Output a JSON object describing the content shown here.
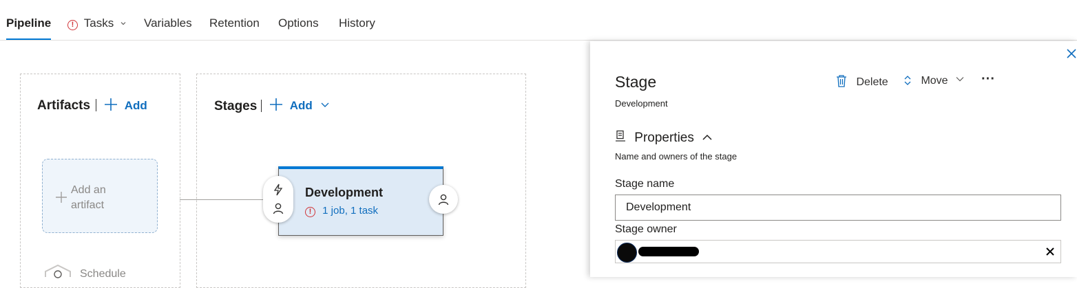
{
  "tabs": [
    {
      "label": "Pipeline",
      "active": true
    },
    {
      "label": "Tasks",
      "warning": true
    },
    {
      "label": "Variables"
    },
    {
      "label": "Retention"
    },
    {
      "label": "Options"
    },
    {
      "label": "History"
    }
  ],
  "artifacts": {
    "title": "Artifacts",
    "add_label": "Add",
    "placeholder_line1": "Add an",
    "placeholder_line2": "artifact",
    "schedule_label": "Schedule"
  },
  "stages": {
    "title": "Stages",
    "add_label": "Add"
  },
  "stage_card": {
    "name": "Development",
    "summary": "1 job, 1 task"
  },
  "panel": {
    "title": "Stage",
    "subtitle": "Development",
    "delete_label": "Delete",
    "move_label": "Move",
    "more_label": "···",
    "properties_label": "Properties",
    "properties_desc": "Name and owners of the stage",
    "stage_name_label": "Stage name",
    "stage_name_value": "Development",
    "stage_owner_label": "Stage owner"
  },
  "colors": {
    "accent": "#0078d4",
    "link": "#106ebe",
    "warning": "#d13438",
    "card_bg": "#deeaf6"
  }
}
